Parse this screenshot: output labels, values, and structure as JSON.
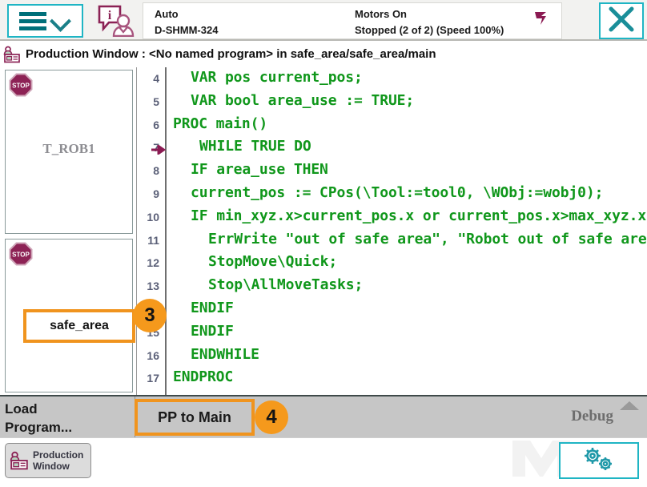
{
  "topbar": {
    "menu_icon": "hamburger-chevron-icon",
    "operator_icon": "operator-info-icon",
    "status": {
      "mode": "Auto",
      "controller": "D-SHMM-324",
      "motors": "Motors On",
      "execution": "Stopped (2 of 2) (Speed 100%)"
    },
    "speed_icon": "speed-indicator-icon",
    "close_icon": "close-icon",
    "accent_color": "#1fb5c4"
  },
  "titlebar": {
    "icon": "production-window-icon",
    "text": "Production Window : <No named program> in safe_area/safe_area/main"
  },
  "tasks": [
    {
      "name": "T_ROB1",
      "stop_icon": "stop-icon",
      "highlighted": false
    },
    {
      "name": "safe_area",
      "stop_icon": "stop-icon",
      "highlighted": true
    }
  ],
  "editor": {
    "lines": [
      {
        "num": "4",
        "indent": 2,
        "text": "VAR pos current_pos;",
        "pp": false
      },
      {
        "num": "5",
        "indent": 2,
        "text": "VAR bool area_use := TRUE;",
        "pp": false
      },
      {
        "num": "6",
        "indent": 0,
        "text": "PROC main()",
        "pp": false
      },
      {
        "num": "7",
        "indent": 3,
        "text": "WHILE TRUE DO",
        "pp": true
      },
      {
        "num": "8",
        "indent": 2,
        "text": "IF area_use THEN",
        "pp": false
      },
      {
        "num": "9",
        "indent": 2,
        "text": "current_pos := CPos(\\Tool:=tool0, \\WObj:=wobj0);",
        "pp": false
      },
      {
        "num": "10",
        "indent": 2,
        "text": "IF min_xyz.x>current_pos.x or current_pos.x>max_xyz.x THEN",
        "pp": false
      },
      {
        "num": "11",
        "indent": 4,
        "text": "ErrWrite \"out of safe area\", \"Robot out of safe area\";",
        "pp": false
      },
      {
        "num": "12",
        "indent": 4,
        "text": "StopMove\\Quick;",
        "pp": false
      },
      {
        "num": "13",
        "indent": 4,
        "text": "Stop\\AllMoveTasks;",
        "pp": false
      },
      {
        "num": "14",
        "indent": 2,
        "text": "ENDIF",
        "pp": false
      },
      {
        "num": "15",
        "indent": 2,
        "text": "ENDIF",
        "pp": false
      },
      {
        "num": "16",
        "indent": 2,
        "text": "ENDWHILE",
        "pp": false
      },
      {
        "num": "17",
        "indent": 0,
        "text": "ENDPROC",
        "pp": false
      }
    ],
    "code_color": "#10971b",
    "pp_arrow_color": "#8b1a52"
  },
  "callouts": [
    {
      "id": "3",
      "label": "3"
    },
    {
      "id": "4",
      "label": "4"
    }
  ],
  "bottombar": {
    "load_program": "Load\nProgram...",
    "load_program_line1": "Load",
    "load_program_line2": "Program...",
    "pp_to_main": "PP to Main",
    "debug": "Debug",
    "up_caret_icon": "caret-up-icon",
    "highlight_color": "#f0941e"
  },
  "taskbar": {
    "button_icon": "production-window-icon",
    "button_line1": "Production",
    "button_line2": "Window",
    "gear_icon": "gears-icon",
    "watermark": "MECH MIND"
  }
}
